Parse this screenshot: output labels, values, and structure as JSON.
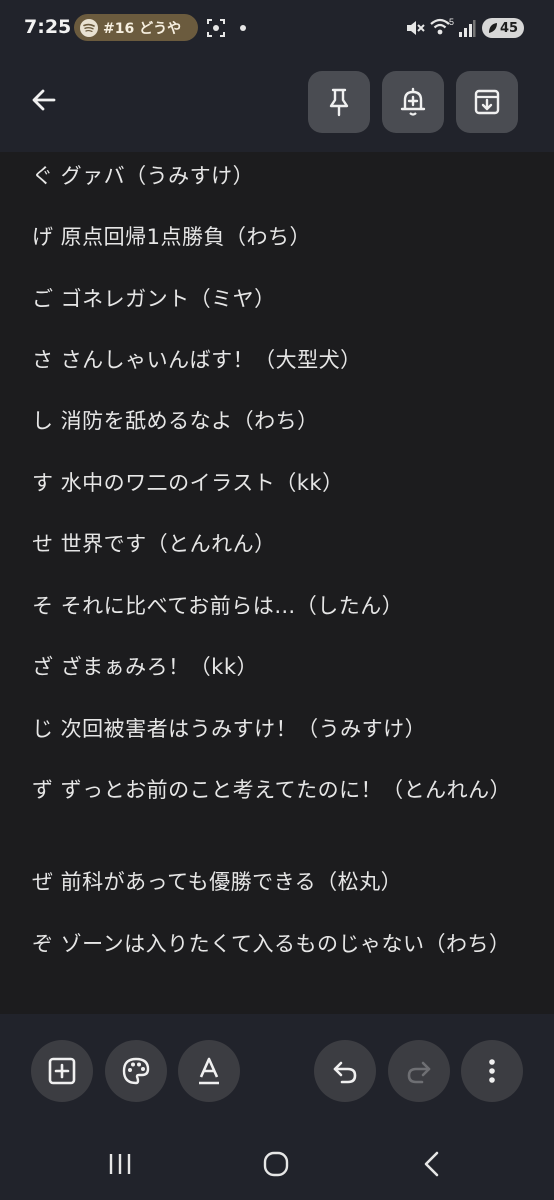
{
  "status_bar": {
    "time": "7:25",
    "media_chip_text": "#16 どうや",
    "battery_level": "45",
    "wifi_badge": "5"
  },
  "note": {
    "lines": [
      "ぐ グァバ（うみすけ）",
      "げ 原点回帰1点勝負（わち）",
      "ご ゴネレガント（ミヤ）",
      "さ さんしゃいんばす！（大型犬）",
      "し 消防を舐めるなよ（わち）",
      "す 水中のワ二のイラスト（kk）",
      "せ 世界です（とんれん）",
      "そ それに比べてお前らは…（したん）",
      "ざ ざまぁみろ！（kk）",
      "じ 次回被害者はうみすけ！（うみすけ）",
      "ず ずっとお前のこと考えてたのに！（とんれん）",
      "ぜ 前科があっても優勝できる（松丸）",
      "ぞ ゾーンは入りたくて入るものじゃない（わち）"
    ]
  },
  "colors": {
    "background": "#1c1c1e",
    "bar": "#21232b",
    "button": "#4a4c52",
    "tool_button": "#3c3d42",
    "media_chip": "#6b5b3e"
  },
  "icons": {
    "back": "arrow-left-icon",
    "pin": "pin-icon",
    "reminder": "bell-plus-icon",
    "archive": "archive-icon",
    "add": "add-box-icon",
    "palette": "palette-icon",
    "text_format": "text-format-icon",
    "undo": "undo-icon",
    "redo": "redo-icon",
    "more": "more-vert-icon"
  }
}
